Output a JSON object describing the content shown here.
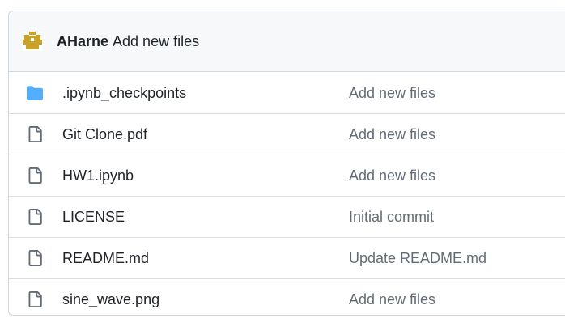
{
  "header": {
    "author": "AHarne",
    "message": "Add new files"
  },
  "colors": {
    "folder_icon": "#54aeff",
    "file_icon": "#636c76",
    "avatar_gold": "#c9a227",
    "header_bg": "#f6f8fa",
    "border": "#d0d7de",
    "muted_text": "#636c76"
  },
  "files": [
    {
      "icon": "folder-icon",
      "name": ".ipynb_checkpoints",
      "commit_message": "Add new files"
    },
    {
      "icon": "file-icon",
      "name": "Git Clone.pdf",
      "commit_message": "Add new files"
    },
    {
      "icon": "file-icon",
      "name": "HW1.ipynb",
      "commit_message": "Add new files"
    },
    {
      "icon": "file-icon",
      "name": "LICENSE",
      "commit_message": "Initial commit"
    },
    {
      "icon": "file-icon",
      "name": "README.md",
      "commit_message": "Update README.md"
    },
    {
      "icon": "file-icon",
      "name": "sine_wave.png",
      "commit_message": "Add new files"
    }
  ]
}
